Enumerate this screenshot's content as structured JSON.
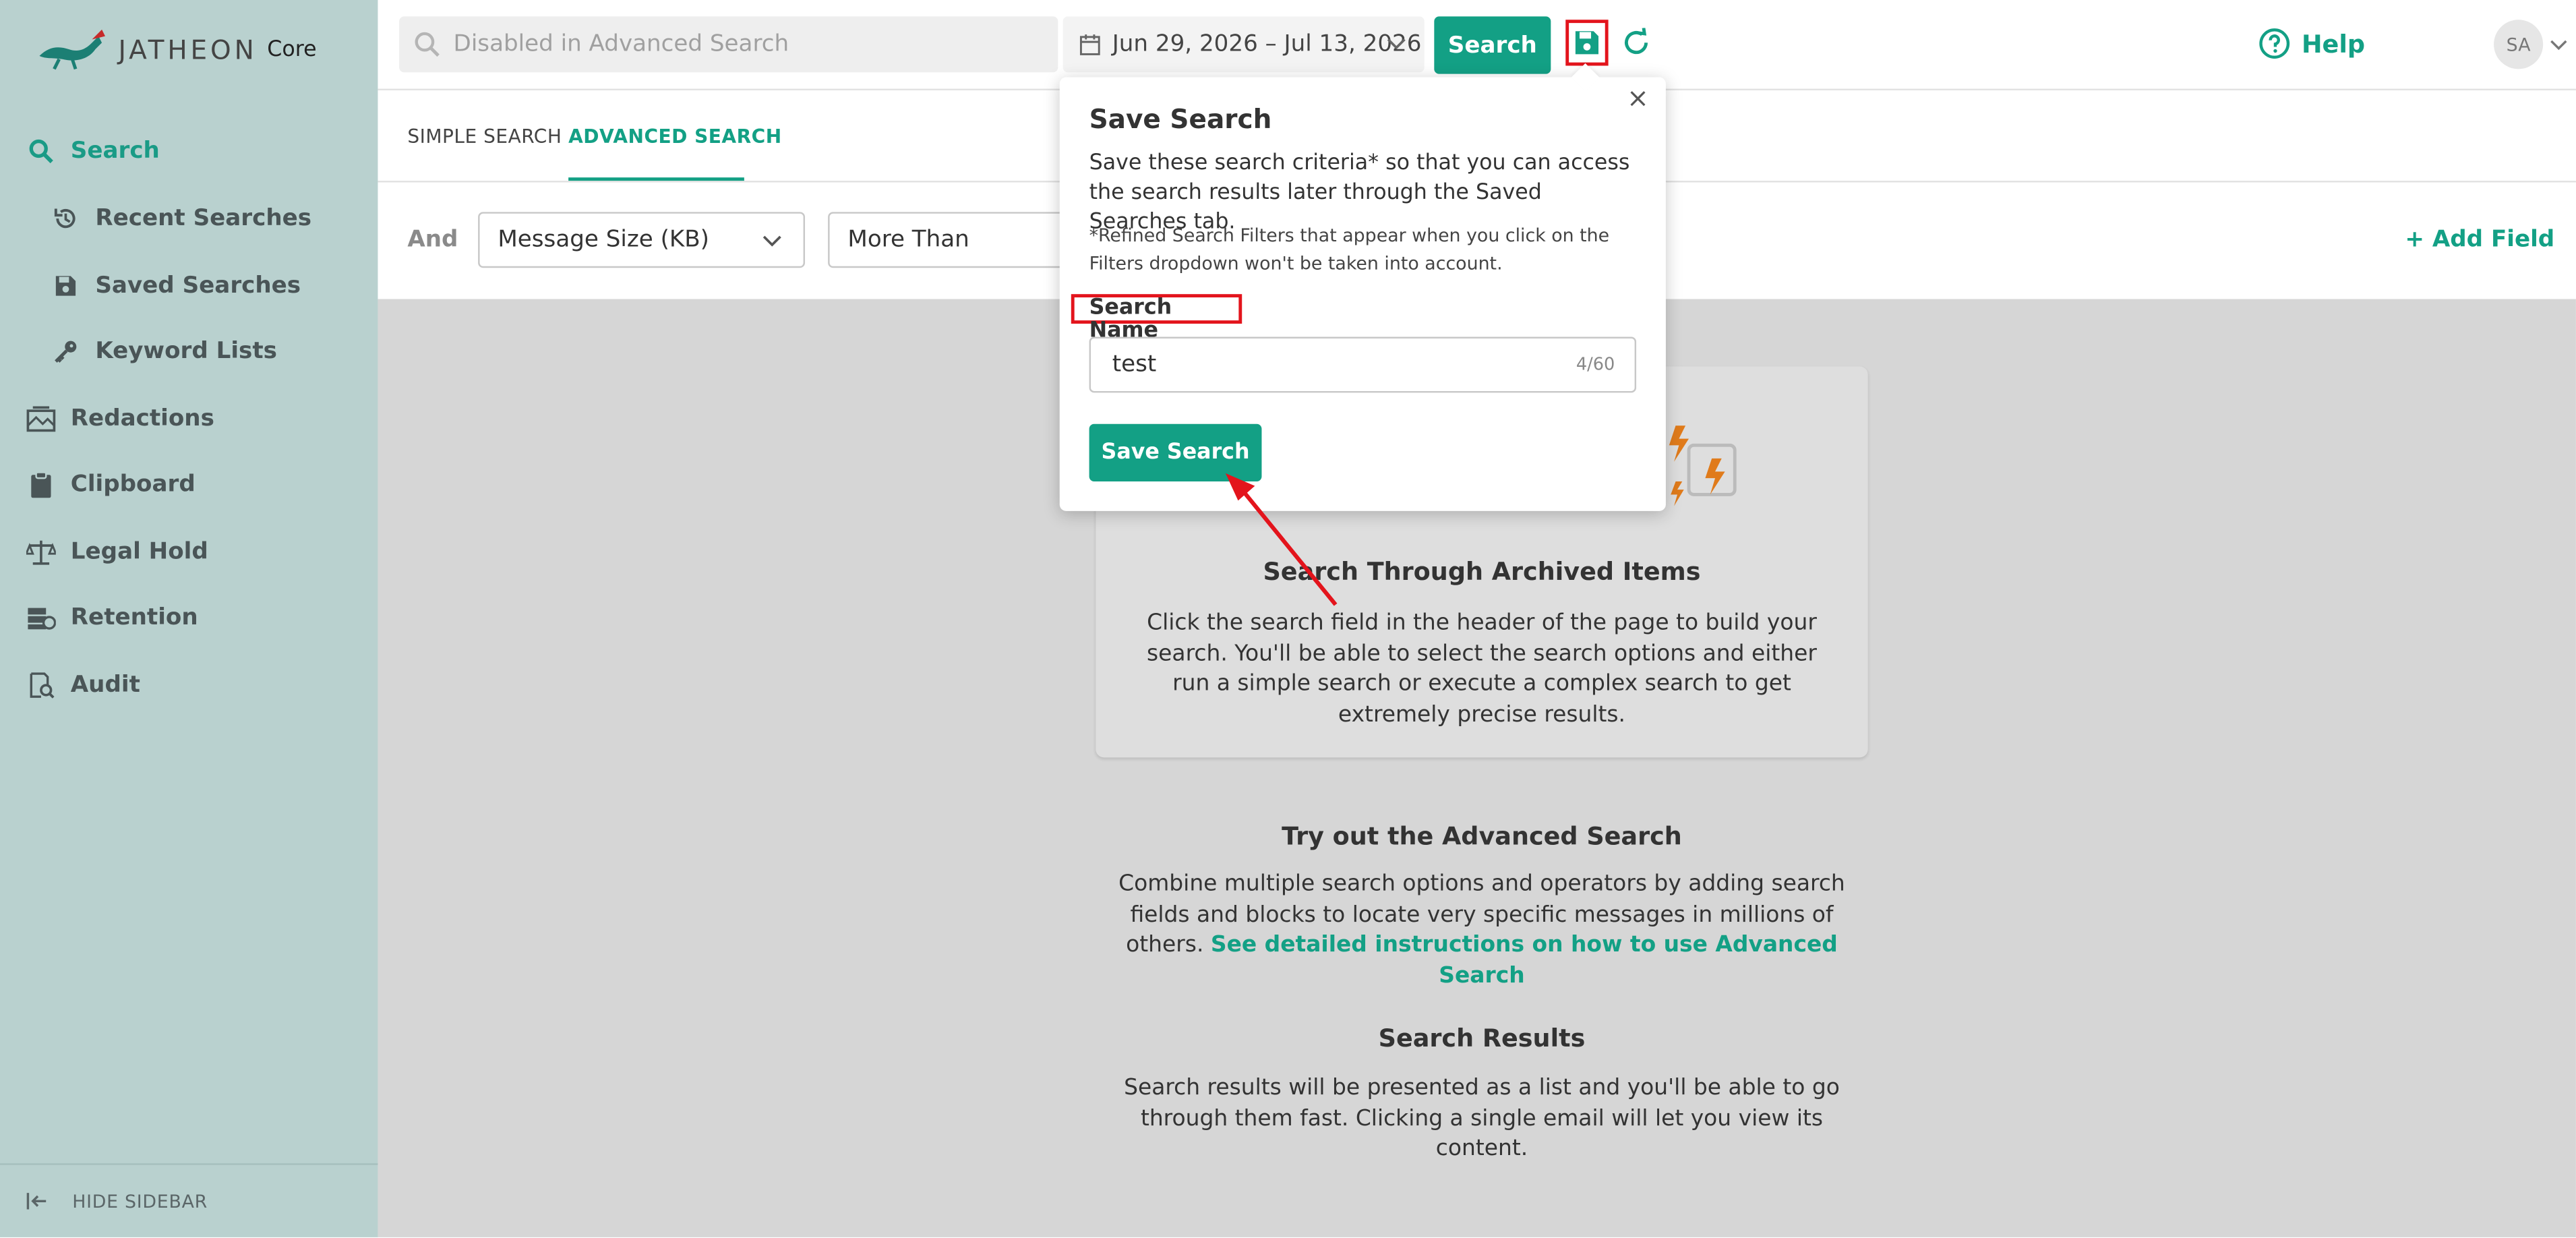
{
  "app": {
    "logo_text": "JATHEON",
    "logo_product": "Core"
  },
  "sidebar": {
    "items": [
      {
        "label": "Search",
        "icon": "search-icon",
        "active": true
      },
      {
        "label": "Recent Searches",
        "icon": "history-icon"
      },
      {
        "label": "Saved Searches",
        "icon": "floppy-disk-icon"
      },
      {
        "label": "Keyword Lists",
        "icon": "key-icon"
      },
      {
        "label": "Redactions",
        "icon": "redaction-icon"
      },
      {
        "label": "Clipboard",
        "icon": "clipboard-icon"
      },
      {
        "label": "Legal Hold",
        "icon": "scales-icon"
      },
      {
        "label": "Retention",
        "icon": "retention-icon"
      },
      {
        "label": "Audit",
        "icon": "audit-icon"
      }
    ],
    "hide_label": "HIDE SIDEBAR"
  },
  "header": {
    "search_placeholder": "Disabled in Advanced Search",
    "date_range": "Jun 29, 2026 – Jul 13, 2026",
    "search_button": "Search",
    "help_label": "Help",
    "avatar_initials": "SA"
  },
  "tabs": [
    {
      "label": "SIMPLE SEARCH"
    },
    {
      "label": "ADVANCED SEARCH",
      "active": true
    }
  ],
  "filter": {
    "operator": "And",
    "field": "Message Size (KB)",
    "condition": "More Than",
    "add_field": "+ Add Field"
  },
  "empty_state": {
    "card_title": "Search Through Archived Items",
    "card_body": "Click the search field in the header of the page to build your search. You'll be able to select the search options and either run a simple search or execute a complex search to get extremely precise results.",
    "advanced_title": "Try out the Advanced Search",
    "advanced_body": "Combine multiple search options and operators by adding search fields and blocks to locate very specific messages in millions of others.",
    "advanced_link": "See detailed instructions on how to use Advanced Search",
    "results_title": "Search Results",
    "results_body": "Search results will be presented as a list and you'll be able to go through them fast. Clicking a single email will let you view its content."
  },
  "save_popover": {
    "title": "Save Search",
    "description": "Save these search criteria* so that you can access the search results later through the Saved Searches tab.",
    "note": "*Refined Search Filters that appear when you click on the Filters dropdown won't be taken into account.",
    "name_label": "Search Name",
    "name_value": "test",
    "char_count": "4/60",
    "save_button": "Save Search",
    "close_glyph": "×"
  },
  "colors": {
    "accent": "#13a085",
    "sidebar_bg": "#b9d1cf",
    "highlight": "#e3141c"
  }
}
